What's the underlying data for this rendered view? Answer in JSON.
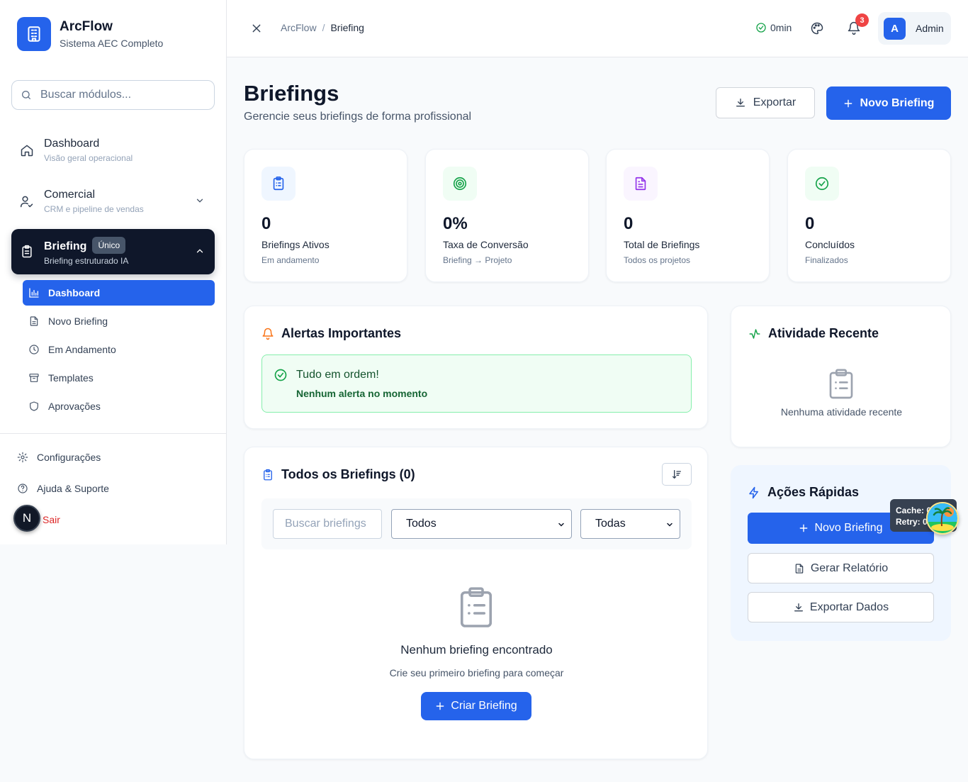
{
  "brand": {
    "name": "ArcFlow",
    "subtitle": "Sistema AEC Completo"
  },
  "search": {
    "placeholder": "Buscar módulos..."
  },
  "nav": [
    {
      "title": "Dashboard",
      "subtitle": "Visão geral operacional",
      "icon": "home-icon"
    },
    {
      "title": "Comercial",
      "subtitle": "CRM e pipeline de vendas",
      "icon": "user-check-icon"
    },
    {
      "title": "Briefing",
      "subtitle": "Briefing estruturado IA",
      "badge": "Único",
      "icon": "clipboard-icon",
      "active": true
    }
  ],
  "subnav": [
    {
      "label": "Dashboard",
      "icon": "bar-chart-icon",
      "active": true
    },
    {
      "label": "Novo Briefing",
      "icon": "file-icon"
    },
    {
      "label": "Em Andamento",
      "icon": "clock-icon"
    },
    {
      "label": "Templates",
      "icon": "archive-icon"
    },
    {
      "label": "Aprovações",
      "icon": "shield-icon"
    }
  ],
  "footer": {
    "settings": "Configurações",
    "help": "Ajuda & Suporte",
    "logout": "Sair",
    "avatar": "N"
  },
  "header": {
    "breadcrumb": [
      "ArcFlow",
      "Briefing"
    ],
    "timer": "0min",
    "notifications": "3",
    "user_initial": "A",
    "user_name": "Admin"
  },
  "page": {
    "title": "Briefings",
    "subtitle": "Gerencie seus briefings de forma profissional",
    "export_label": "Exportar",
    "new_label": "Novo Briefing"
  },
  "stats": [
    {
      "value": "0",
      "label": "Briefings Ativos",
      "sub": "Em andamento",
      "color": "#2563eb",
      "bg": "#eff6ff",
      "icon": "clipboard-list-icon"
    },
    {
      "value": "0%",
      "label": "Taxa de Conversão",
      "sub": "Briefing → Projeto",
      "color": "#16a34a",
      "bg": "#f0fdf4",
      "icon": "target-icon"
    },
    {
      "value": "0",
      "label": "Total de Briefings",
      "sub": "Todos os projetos",
      "color": "#9333ea",
      "bg": "#faf5ff",
      "icon": "file-text-icon"
    },
    {
      "value": "0",
      "label": "Concluídos",
      "sub": "Finalizados",
      "color": "#16a34a",
      "bg": "#f0fdf4",
      "icon": "check-circle-icon"
    }
  ],
  "alerts": {
    "title": "Alertas Importantes",
    "ok_title": "Tudo em ordem!",
    "ok_sub": "Nenhum alerta no momento"
  },
  "activity": {
    "title": "Atividade Recente",
    "empty": "Nenhuma atividade recente"
  },
  "briefings": {
    "title": "Todos os Briefings (0)",
    "search_placeholder": "Buscar briefings",
    "status_select": "Todos",
    "priority_select": "Todas",
    "empty_title": "Nenhum briefing encontrado",
    "empty_sub": "Crie seu primeiro briefing para começar",
    "create_label": "Criar Briefing"
  },
  "quick": {
    "title": "Ações Rápidas",
    "new_label": "Novo Briefing",
    "report_label": "Gerar Relatório",
    "export_label": "Exportar Dados"
  },
  "debug": {
    "cache": "Cache: 0",
    "retry": "Retry: 0"
  },
  "colors": {
    "primary": "#2563eb",
    "dark": "#0f172a",
    "success": "#16a34a",
    "danger": "#ef4444",
    "orange": "#f97316"
  }
}
